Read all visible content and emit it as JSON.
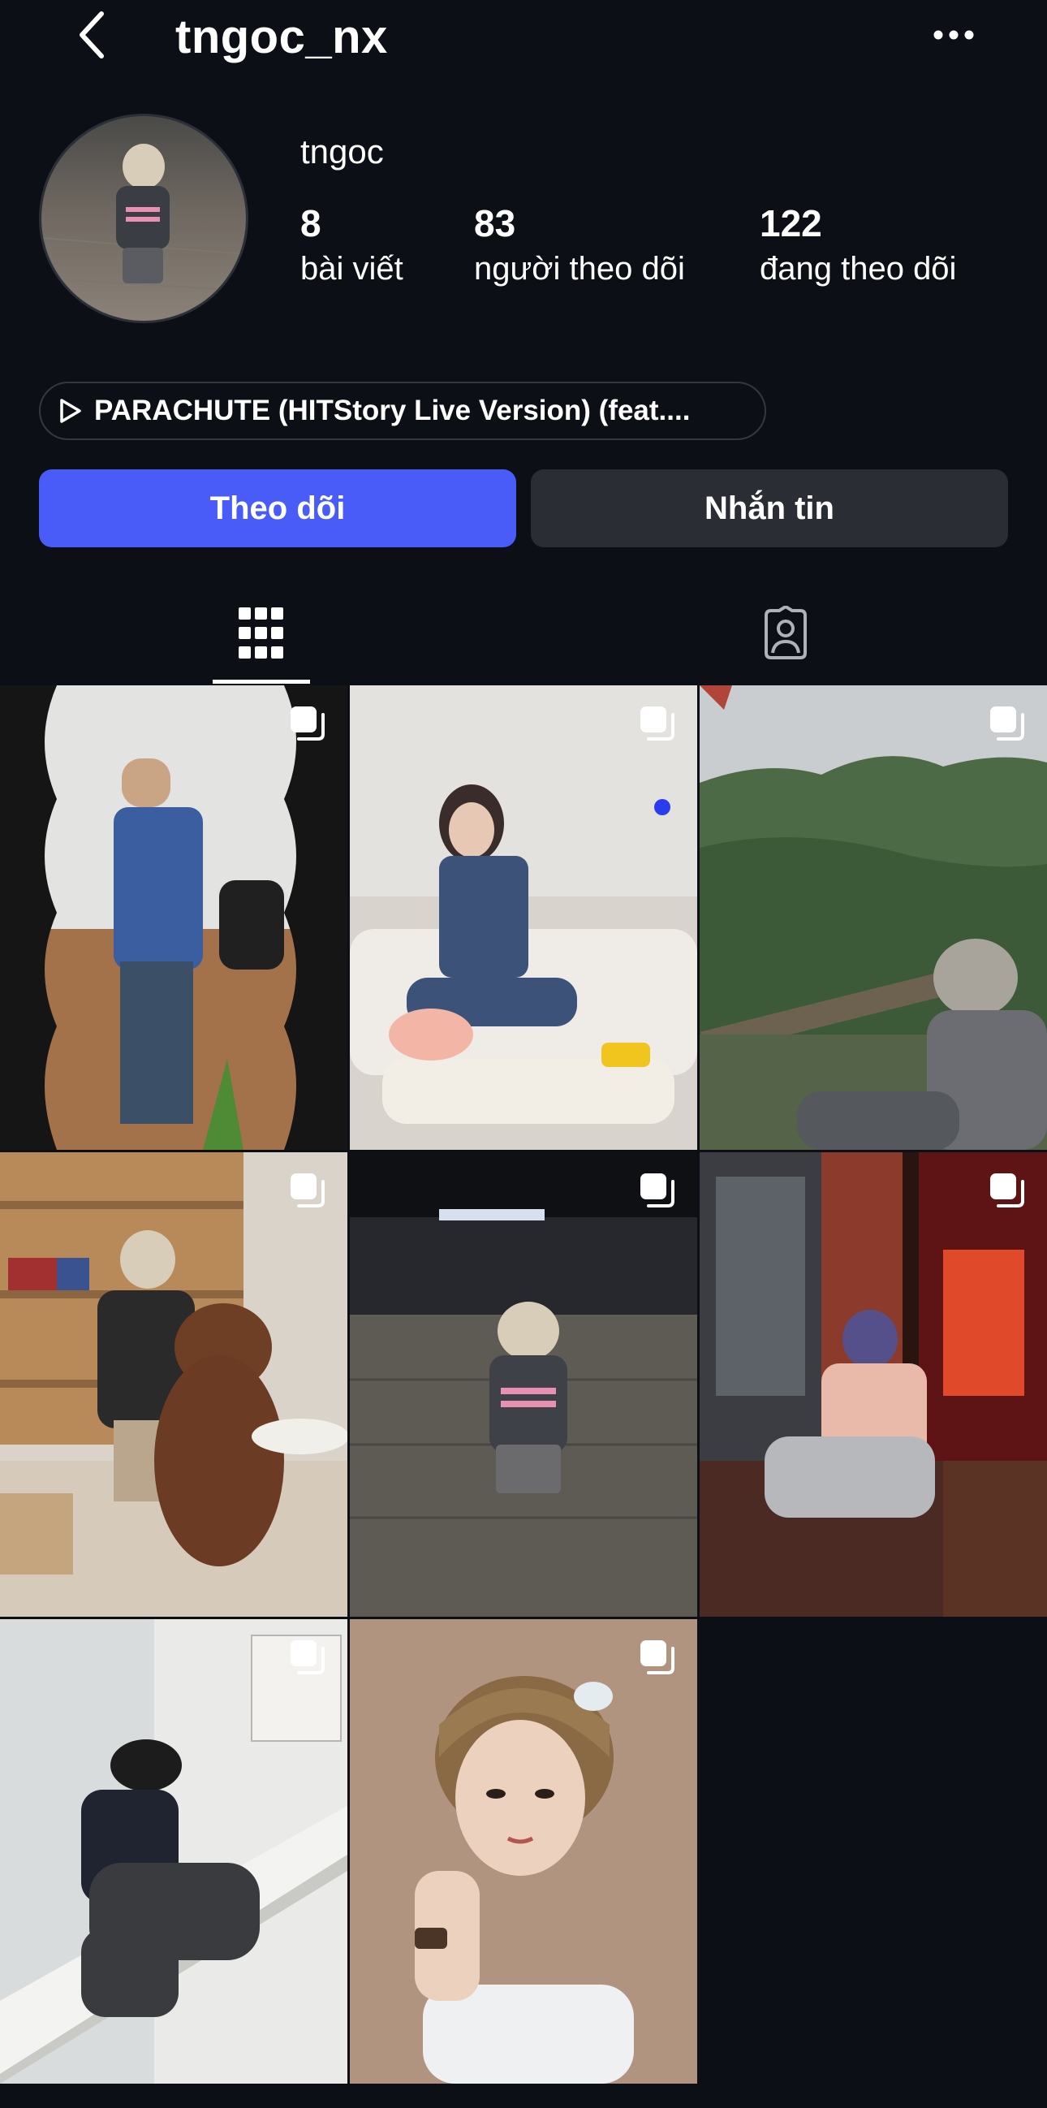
{
  "header": {
    "username": "tngoc_nx",
    "back_icon": "chevron-left-icon",
    "more_icon": "ellipsis-icon"
  },
  "profile": {
    "display_name": "tngoc",
    "stats": [
      {
        "value": "8",
        "label": "bài viết"
      },
      {
        "value": "83",
        "label": "người theo dõi"
      },
      {
        "value": "122",
        "label": "đang theo dõi"
      }
    ]
  },
  "music": {
    "icon": "play-icon",
    "label": "PARACHUTE (HITStory Live Version) (feat...."
  },
  "actions": {
    "follow_label": "Theo dõi",
    "message_label": "Nhắn tin"
  },
  "tabs": [
    {
      "icon": "grid-icon",
      "selected": true
    },
    {
      "icon": "tagged-person-icon",
      "selected": false
    }
  ],
  "colors": {
    "background": "#0c0f16",
    "follow_button": "#4a5cf7",
    "message_button": "#2a2d34"
  },
  "posts": [
    {
      "multi": true
    },
    {
      "multi": true
    },
    {
      "multi": true
    },
    {
      "multi": true
    },
    {
      "multi": true
    },
    {
      "multi": true
    },
    {
      "multi": true
    },
    {
      "multi": true
    }
  ]
}
